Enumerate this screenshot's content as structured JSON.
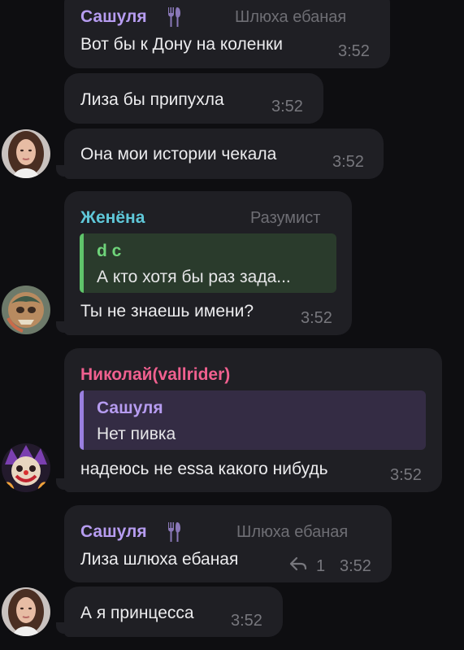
{
  "colors": {
    "background": "#0e0e11",
    "bubble": "#1f1f24",
    "name_sashulya": "#b69cf0",
    "name_zhenya": "#5fc7d8",
    "name_nikolai": "#f0608f",
    "quote_green_bg": "#2a3b2c",
    "quote_green_bar": "#5fc46a",
    "quote_purple_bg": "#342c44",
    "quote_purple_bar": "#9a7fe0"
  },
  "messages": [
    {
      "sender": "Сашуля",
      "tag": "Шлюха ебаная",
      "icon": "fork-knife-icon",
      "text": "Вот бы к Дону на коленки",
      "time": "3:52"
    },
    {
      "text": "Лиза бы припухла",
      "time": "3:52"
    },
    {
      "avatar": "avatar-woman",
      "text": "Она мои истории чекала",
      "time": "3:52"
    },
    {
      "sender": "Женёна",
      "tag": "Разумист",
      "quote": {
        "name": "d c",
        "text": "А кто хотя бы раз зада..."
      },
      "avatar": "avatar-skull-painting",
      "text": "Ты не знаешь имени?",
      "time": "3:52"
    },
    {
      "sender": "Николай(vallrider)",
      "quote": {
        "name": "Сашуля",
        "text": "Нет пивка"
      },
      "avatar": "avatar-clown",
      "text": "надеюсь не essa какого нибудь",
      "time": "3:52"
    },
    {
      "sender": "Сашуля",
      "tag": "Шлюха ебаная",
      "icon": "fork-knife-icon",
      "text": "Лиза шлюха ебаная",
      "replies": "1",
      "reply_icon": "reply-arrow-icon",
      "time": "3:52"
    },
    {
      "avatar": "avatar-woman",
      "text": "А я принцесса",
      "time": "3:52"
    }
  ]
}
